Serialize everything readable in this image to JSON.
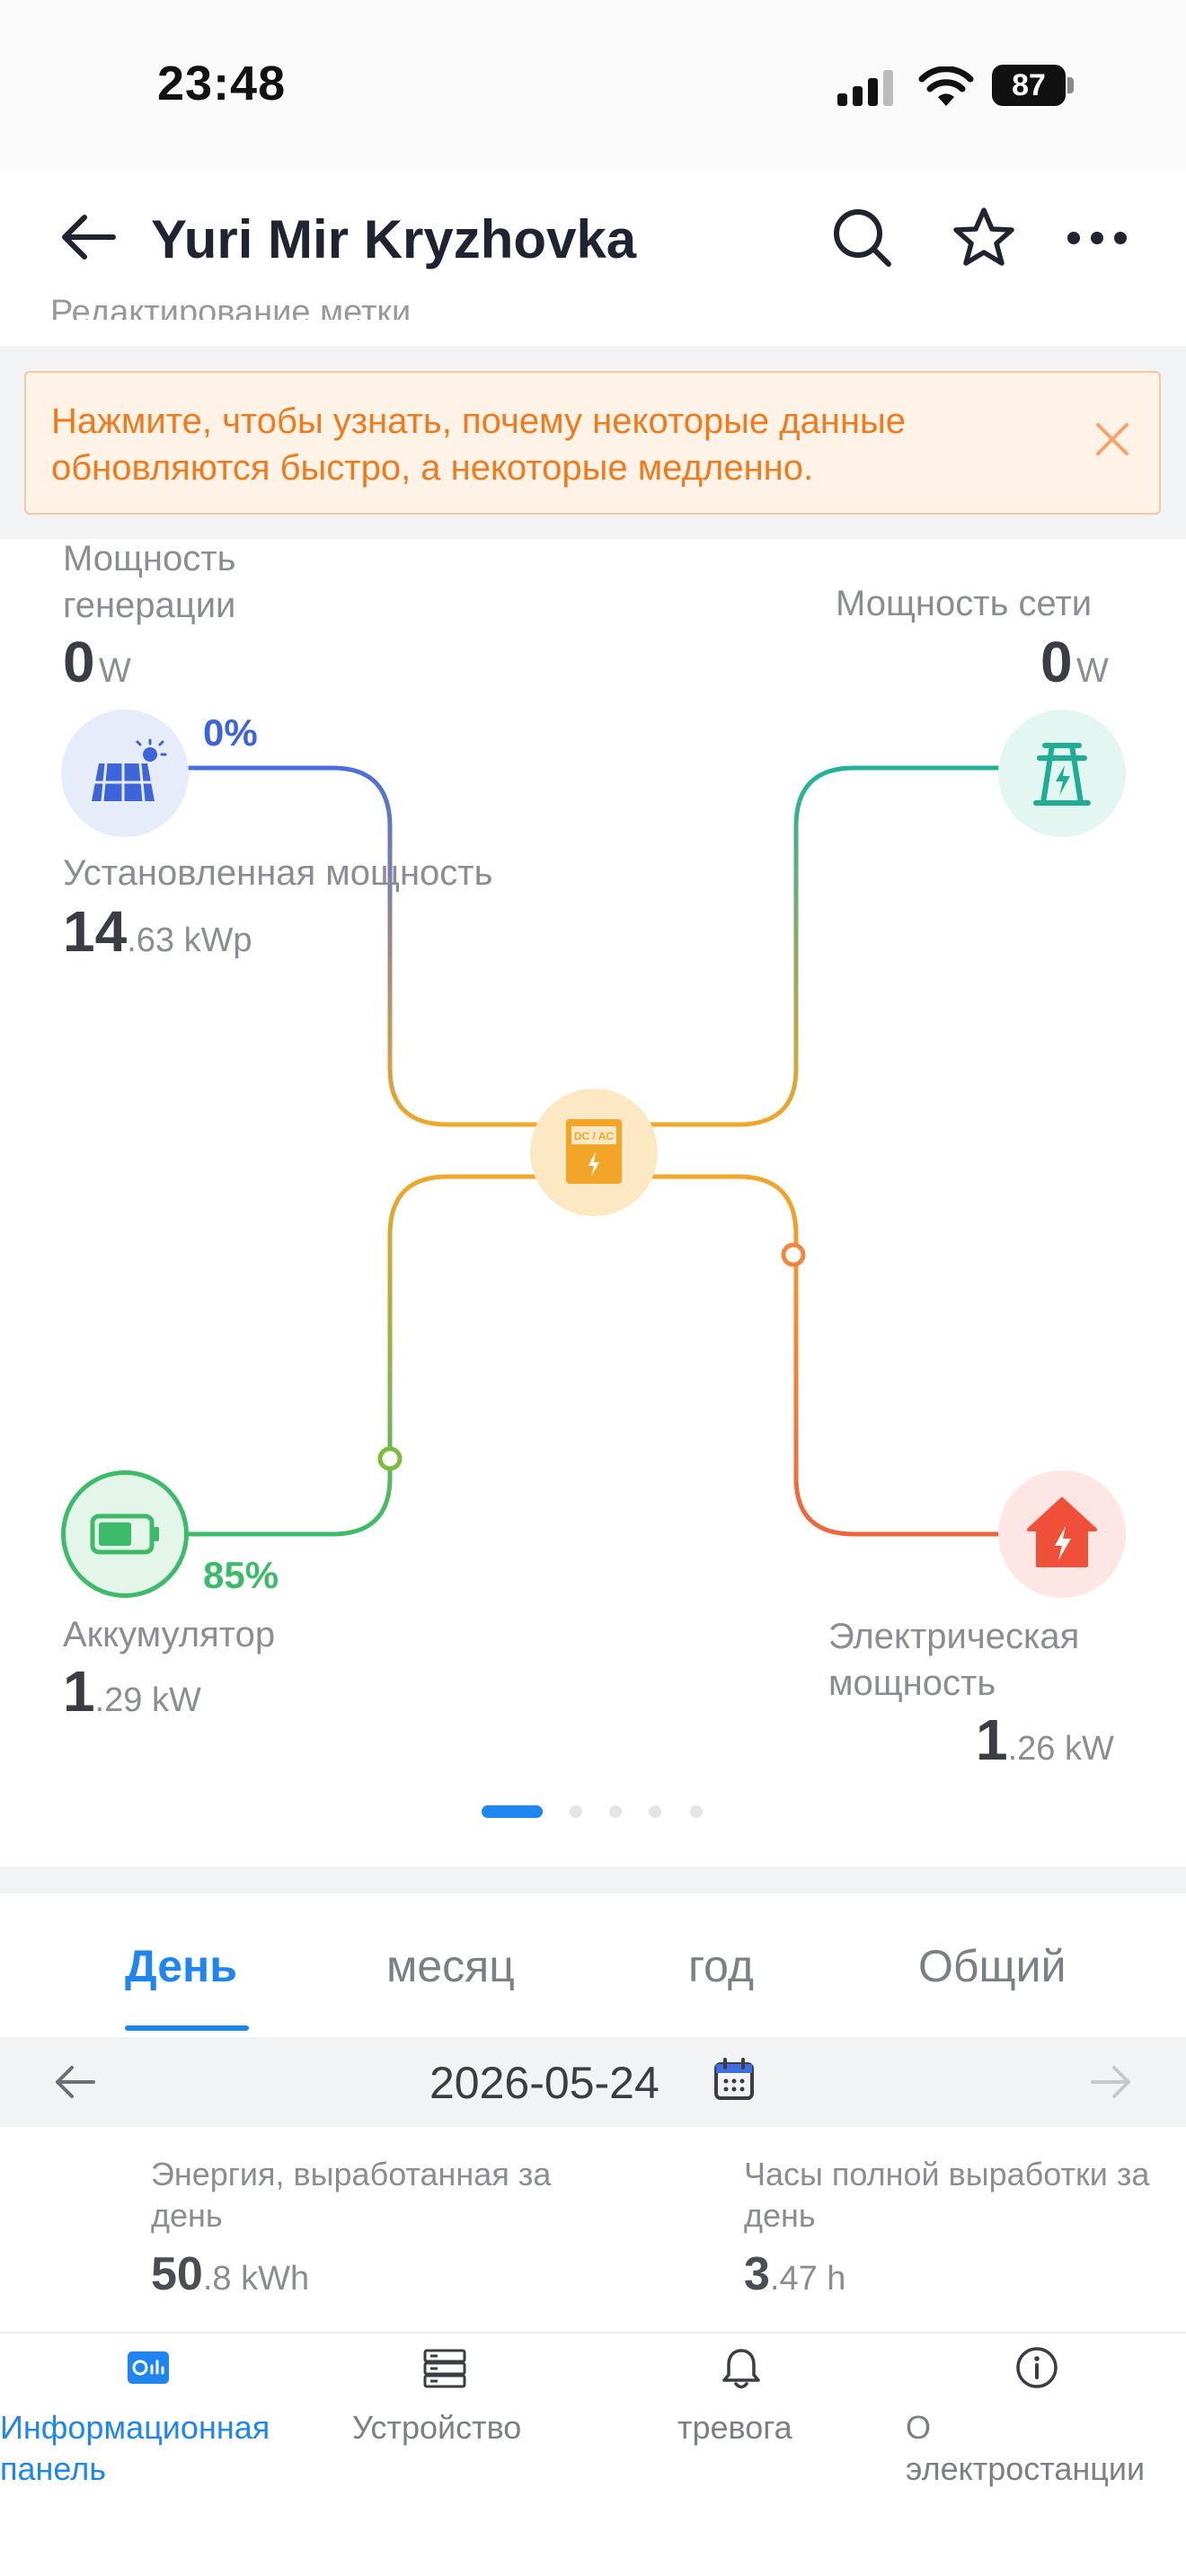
{
  "status_bar": {
    "time": "23:48",
    "battery": "87"
  },
  "header": {
    "title": "Yuri Mir Kryzhovka",
    "subtitle_partial": "Редактирование метки"
  },
  "banner": {
    "text": "Нажмите, чтобы узнать, почему некоторые данные обновляются быстро, а некоторые медленно."
  },
  "flow": {
    "generation": {
      "label_line1": "Мощность",
      "label_line2": "генерации",
      "value": "0",
      "unit": "W",
      "percent": "0%"
    },
    "grid": {
      "label": "Мощность сети",
      "value": "0",
      "unit": "W"
    },
    "installed": {
      "label": "Установленная мощность",
      "value_int": "14",
      "value_dec": ".63 kWp"
    },
    "battery": {
      "label": "Аккумулятор",
      "percent": "85%",
      "value_int": "1",
      "value_dec": ".29 kW"
    },
    "load": {
      "label_line1": "Электрическая",
      "label_line2": "мощность",
      "value_int": "1",
      "value_dec": ".26 kW"
    },
    "inverter_label": "DC / AC"
  },
  "tabs": [
    "День",
    "месяц",
    "год",
    "Общий"
  ],
  "date": "2026-05-24",
  "stats": {
    "energy": {
      "label_line1": "Энергия, выработанная за",
      "label_line2": "день",
      "value_int": "50",
      "value_dec": ".8 kWh"
    },
    "hours": {
      "label_line1": "Часы полной выработки за",
      "label_line2": "день",
      "value_int": "3",
      "value_dec": ".47 h"
    }
  },
  "bottom_nav": {
    "dashboard_line1": "Информационная",
    "dashboard_line2": "панель",
    "device": "Устройство",
    "alarm": "тревога",
    "about_line1": "О",
    "about_line2": "электростанции"
  },
  "colors": {
    "accent": "#1f86f0",
    "banner_text": "#f07a1e",
    "solar_line": "#4a6fdc",
    "grid_line": "#22b39a",
    "battery_line": "#3dbb6a",
    "load_line": "#f0633f",
    "inverter": "#f3a52a"
  }
}
